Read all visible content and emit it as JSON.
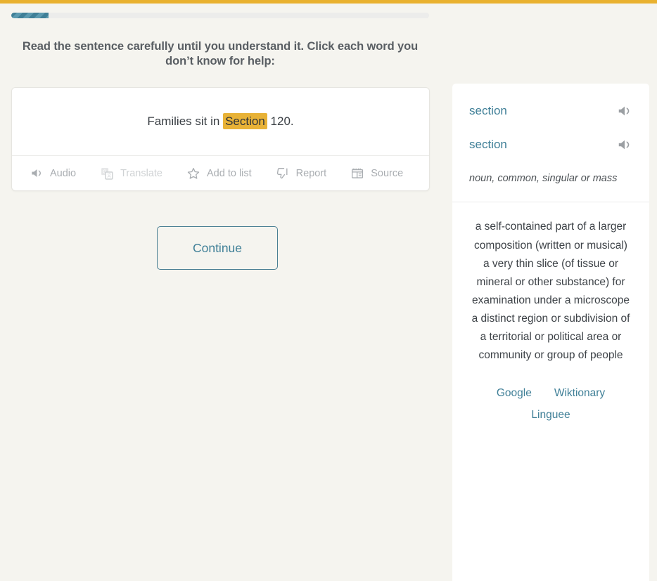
{
  "theme": {
    "accent_bar": "#e9b12f",
    "page_bg": "#f5f4ef",
    "teal": "#3f7f97",
    "highlight": "#e8b236"
  },
  "progress": {
    "percent": 9,
    "label": ""
  },
  "instructions": {
    "text": "Read the sentence carefully until you understand it. Click each word you don’t know for help:"
  },
  "sentence": {
    "words": [
      {
        "text": "Families",
        "selected": false
      },
      {
        "text": "sit",
        "selected": false
      },
      {
        "text": "in",
        "selected": false
      },
      {
        "text": "Section",
        "selected": true
      },
      {
        "text": "120.",
        "selected": false
      }
    ],
    "full_text": "Families sit in Section 120."
  },
  "toolbar": {
    "items": [
      {
        "label": "Audio",
        "icon": "speaker-icon",
        "disabled": false
      },
      {
        "label": "Translate",
        "icon": "google-translate-icon",
        "disabled": true
      },
      {
        "label": "Add to list",
        "icon": "star-icon",
        "disabled": false
      },
      {
        "label": "Report",
        "icon": "thumbs-down-icon",
        "disabled": false
      },
      {
        "label": "Source",
        "icon": "newspaper-icon",
        "disabled": false
      }
    ]
  },
  "continue_button": {
    "label": "Continue"
  },
  "sidebar": {
    "headword": "section",
    "lemma": "section",
    "part_of_speech": "noun, common, singular or mass",
    "audio_icon": "speaker-icon",
    "definitions": [
      "a self-contained part of a larger composition (written or musical)",
      "a very thin slice (of tissue or mineral or other substance) for examination under a microscope",
      "a distinct region or subdivision of a territorial or political area or community or group of people"
    ],
    "external_links_row1": [
      {
        "label": "Google"
      },
      {
        "label": "Wiktionary"
      }
    ],
    "external_links_row2": [
      {
        "label": "Linguee"
      }
    ]
  }
}
